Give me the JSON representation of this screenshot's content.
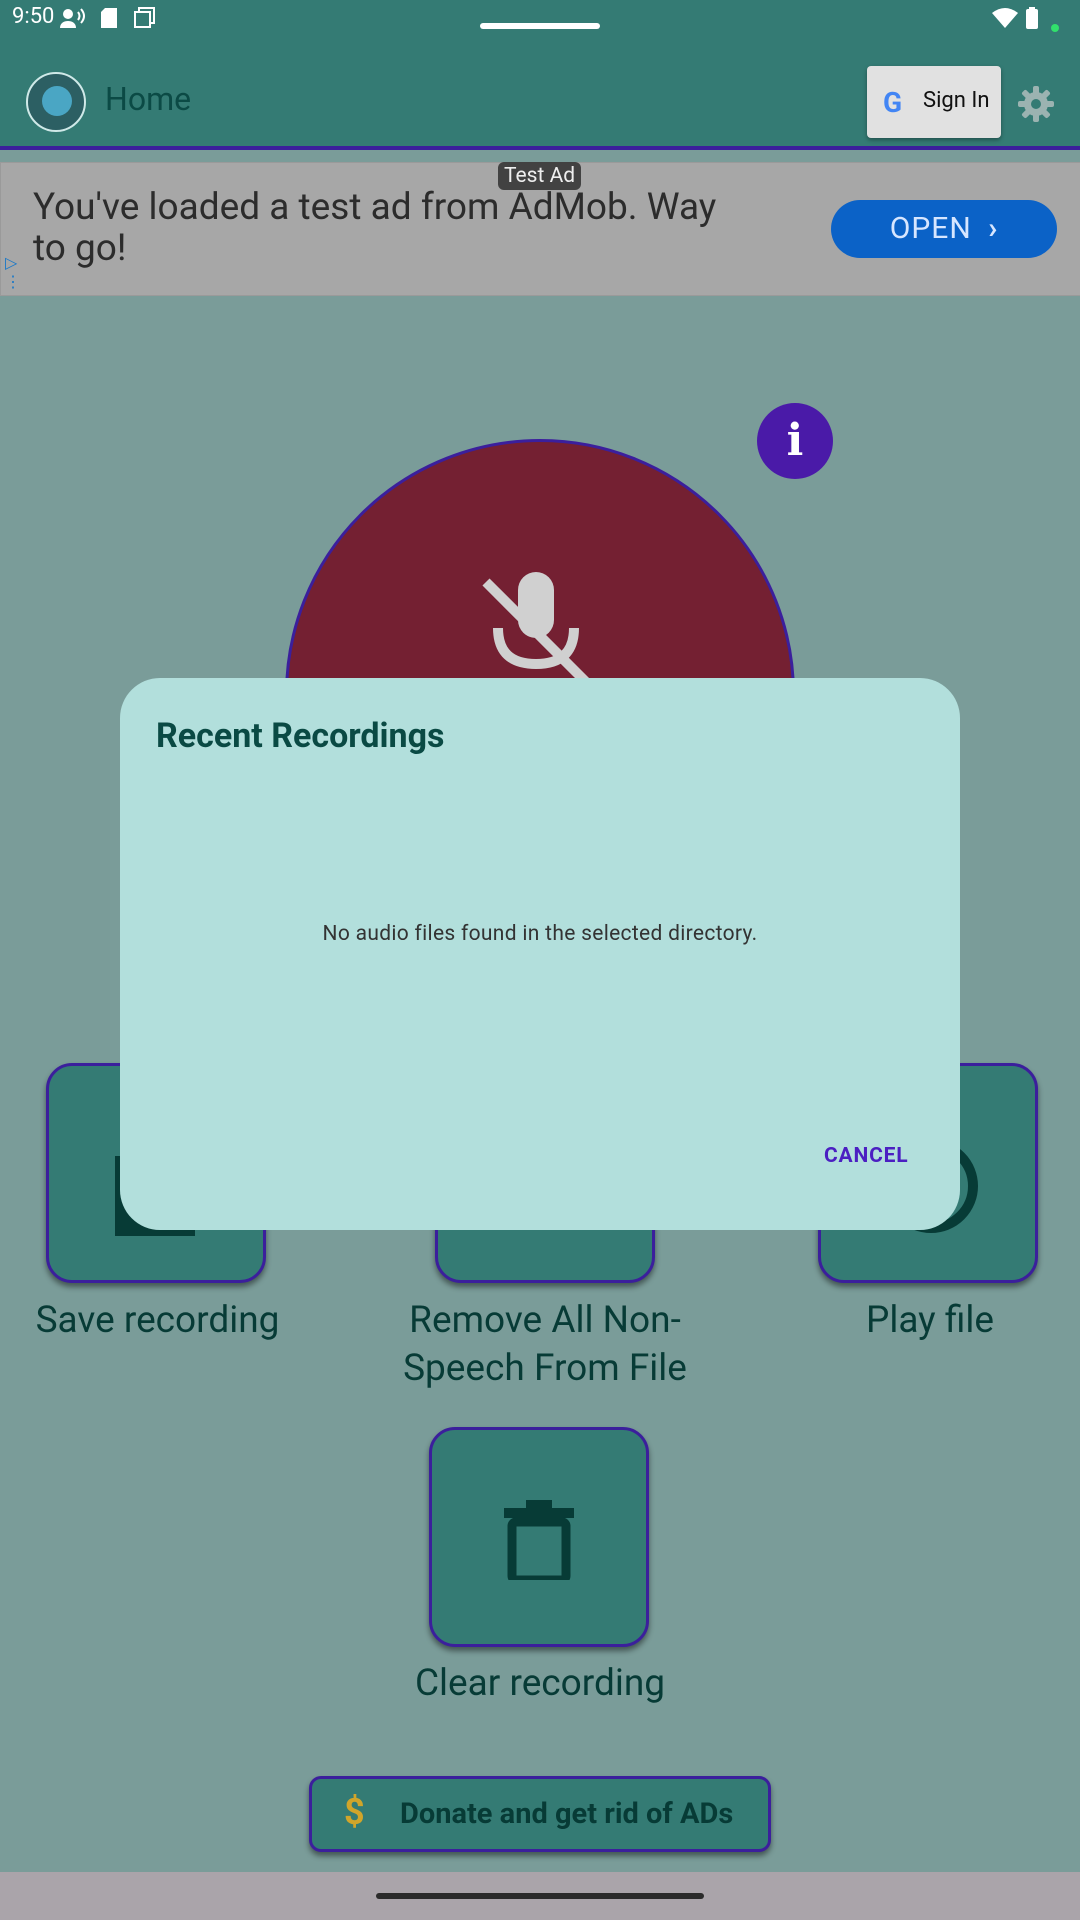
{
  "status_bar": {
    "time": "9:50"
  },
  "app_bar": {
    "title": "Home",
    "sign_in_label": "Sign In"
  },
  "ad": {
    "tag": "Test Ad",
    "text": "You've loaded a test ad from AdMob. Way to go!",
    "open_label": "OPEN"
  },
  "main": {
    "info_label": "i",
    "tiles": [
      {
        "label": "Save recording"
      },
      {
        "label": "Remove All Non-Speech From File"
      },
      {
        "label": "Play file"
      },
      {
        "label": "Clear recording"
      }
    ],
    "donate_label": "Donate and get rid of ADs",
    "donate_icon": "$"
  },
  "dialog": {
    "title": "Recent Recordings",
    "message": "No audio files found in the selected directory.",
    "cancel_label": "CANCEL"
  },
  "colors": {
    "primary": "#347b74",
    "accent": "#3b1f9c",
    "record": "#742032",
    "dialog_bg": "#b2dfdc"
  }
}
